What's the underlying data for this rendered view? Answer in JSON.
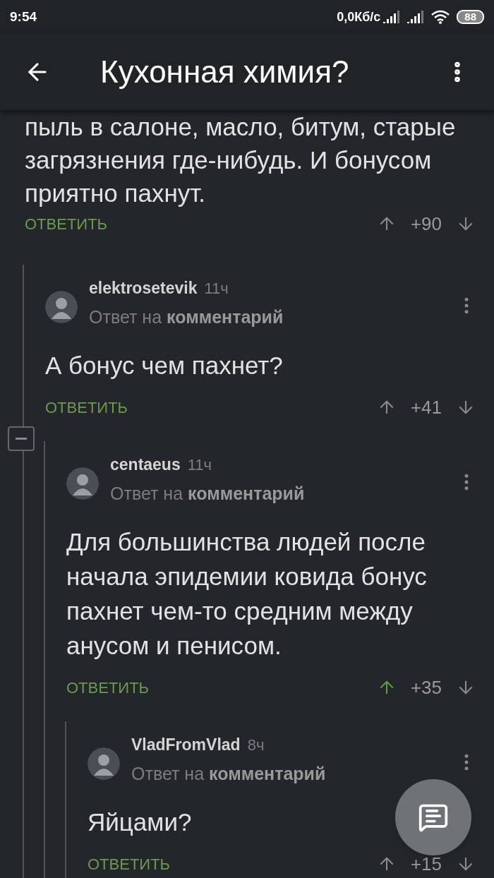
{
  "status_bar": {
    "time": "9:54",
    "speed": "0,0Кб/с",
    "battery": "88"
  },
  "header": {
    "title": "Кухонная химия?"
  },
  "thread": {
    "body": "пыль в салоне, масло, битум, старые загрязнения где-нибудь. И бонусом приятно пахнут.",
    "reply_label": "ОТВЕТИТЬ",
    "score": "+90",
    "upvoted": false,
    "children": [
      {
        "author": "elektrosetevik",
        "time": "11ч",
        "reply_to": "Ответ на **комментарий**",
        "body": "А бонус чем пахнет?",
        "reply_label": "ОТВЕТИТЬ",
        "score": "+41",
        "upvoted": false,
        "expanded": true,
        "children": [
          {
            "author": "centaeus",
            "time": "11ч",
            "reply_to": "Ответ на **комментарий**",
            "body": "Для большинства людей после начала эпидемии ковида бонус пахнет чем-то средним между анусом и пенисом.",
            "reply_label": "ОТВЕТИТЬ",
            "score": "+35",
            "upvoted": true,
            "children": [
              {
                "author": "VladFromVlad",
                "time": "8ч",
                "reply_to": "Ответ на **комментарий**",
                "body": "Яйцами?",
                "reply_label": "ОТВЕТИТЬ",
                "score": "+15",
                "upvoted": false
              }
            ]
          }
        ]
      }
    ]
  }
}
